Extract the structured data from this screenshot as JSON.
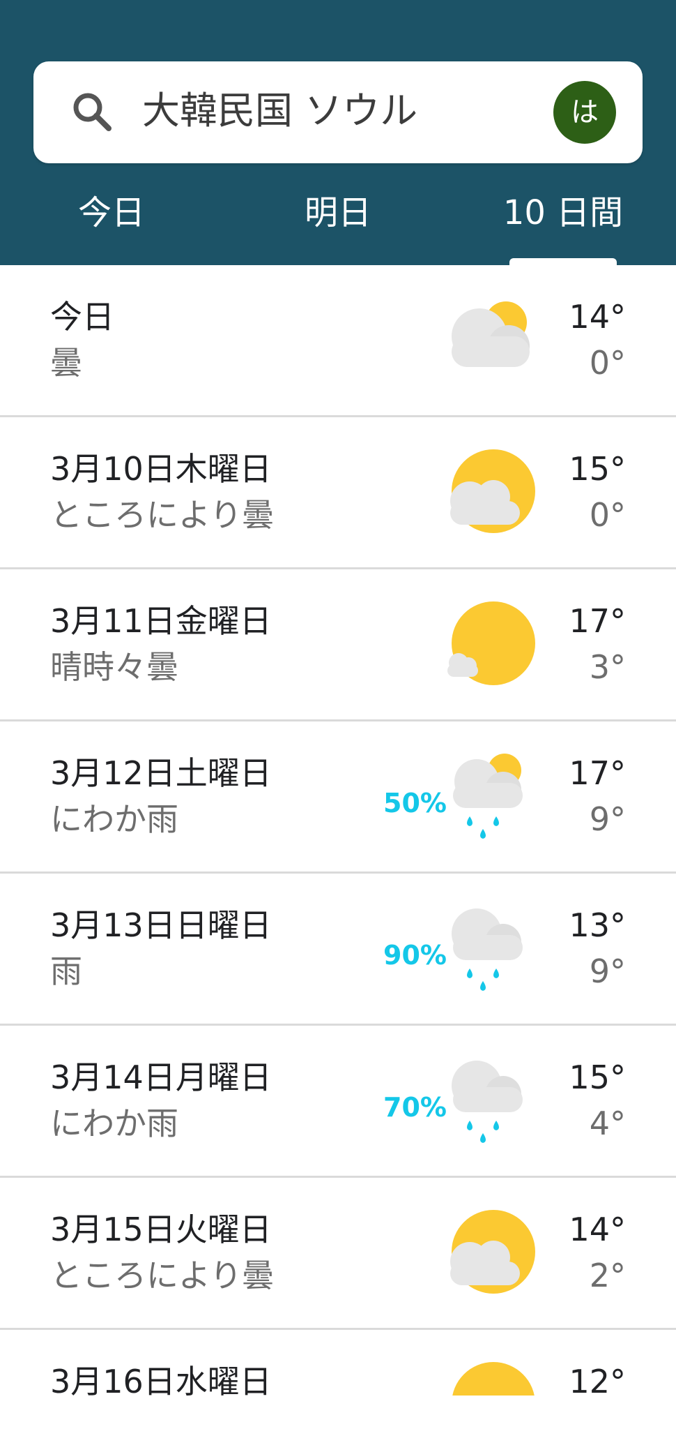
{
  "search": {
    "query": "大韓民国 ソウル",
    "avatar_letter": "は"
  },
  "tabs": [
    {
      "label": "今日"
    },
    {
      "label": "明日"
    },
    {
      "label": "10 日間"
    }
  ],
  "forecast": [
    {
      "date": "今日",
      "condition": "曇",
      "high": "14°",
      "low": "0°",
      "precip": "",
      "icon": "cloudy-sun-icon"
    },
    {
      "date": "3月10日木曜日",
      "condition": "ところにより曇",
      "high": "15°",
      "low": "0°",
      "precip": "",
      "icon": "partly-cloudy-icon"
    },
    {
      "date": "3月11日金曜日",
      "condition": "晴時々曇",
      "high": "17°",
      "low": "3°",
      "precip": "",
      "icon": "mostly-sunny-icon"
    },
    {
      "date": "3月12日土曜日",
      "condition": "にわか雨",
      "high": "17°",
      "low": "9°",
      "precip": "50%",
      "icon": "sun-showers-icon"
    },
    {
      "date": "3月13日日曜日",
      "condition": "雨",
      "high": "13°",
      "low": "9°",
      "precip": "90%",
      "icon": "rain-icon"
    },
    {
      "date": "3月14日月曜日",
      "condition": "にわか雨",
      "high": "15°",
      "low": "4°",
      "precip": "70%",
      "icon": "rain-icon"
    },
    {
      "date": "3月15日火曜日",
      "condition": "ところにより曇",
      "high": "14°",
      "low": "2°",
      "precip": "",
      "icon": "partly-cloudy-icon"
    },
    {
      "date": "3月16日水曜日",
      "condition": "",
      "high": "12°",
      "low": "",
      "precip": "",
      "icon": "sun-icon"
    }
  ],
  "colors": {
    "header": "#1c5367",
    "precip": "#14c7e8",
    "sun": "#fbc932",
    "cloud": "#e6e6e6",
    "avatar": "#2d5f16"
  }
}
